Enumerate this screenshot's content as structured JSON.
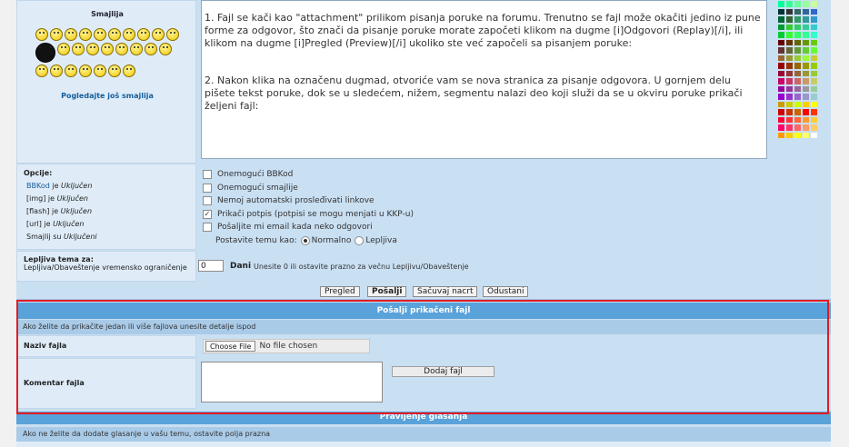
{
  "smilies": {
    "title": "Smajlija",
    "more_link": "Pogledajte još smajlija"
  },
  "editor": {
    "paragraph1": "1. Fajl se kači kao \"attachment\" prilikom pisanja poruke na forumu. Trenutno se fajl može okačiti jedino iz pune forme za odgovor, što znači da pisanje poruke morate započeti klikom na dugme [i]Odgovori (Replay)[/i], ili klikom na dugme [i]Pregled (Preview)[/i] ukoliko ste već započeli sa pisanjem poruke:",
    "paragraph2": "2. Nakon klika na označenu dugmad, otvoriće vam se nova stranica za pisanje odgovora. U gornjem delu pišete tekst poruke, dok se u sledećem, nižem, segmentu nalazi deo koji služi da se u okviru poruke prikači željeni fajl:"
  },
  "palette": {
    "colors": [
      "#00ff99",
      "#33ff99",
      "#66ff99",
      "#99ff99",
      "#ccff99",
      "#003333",
      "#333333",
      "#336666",
      "#336699",
      "#3366cc",
      "#006633",
      "#336633",
      "#339966",
      "#339999",
      "#3399cc",
      "#009933",
      "#33cc33",
      "#33cc66",
      "#33cc99",
      "#33cccc",
      "#00cc33",
      "#33ff33",
      "#33ff66",
      "#33ff99",
      "#33ffcc",
      "#660000",
      "#663300",
      "#666600",
      "#669900",
      "#66cc00",
      "#663333",
      "#666633",
      "#669933",
      "#66cc33",
      "#66ff33",
      "#996633",
      "#999933",
      "#99cc33",
      "#99ff33",
      "#cccc33",
      "#990000",
      "#993300",
      "#996600",
      "#999900",
      "#99cc00",
      "#990033",
      "#993333",
      "#996633",
      "#999933",
      "#99cc33",
      "#cc0066",
      "#cc3366",
      "#cc6666",
      "#cc9966",
      "#cccc66",
      "#990099",
      "#993399",
      "#996699",
      "#999999",
      "#99cc99",
      "#9900cc",
      "#9933cc",
      "#9966cc",
      "#9999cc",
      "#99cccc",
      "#cc9900",
      "#cccc00",
      "#ccff00",
      "#ffcc00",
      "#ffff00",
      "#cc0000",
      "#cc3300",
      "#cc6600",
      "#ff0000",
      "#ff3300",
      "#ff0033",
      "#ff3333",
      "#ff6633",
      "#ff9933",
      "#ffcc33",
      "#ff0066",
      "#ff3366",
      "#ff6666",
      "#ff9966",
      "#ffcc66",
      "#ff9900",
      "#ffcc00",
      "#ffff00",
      "#ffff66",
      "#ffffff"
    ]
  },
  "options": {
    "title": "Opcije:",
    "bbcode_link": "BBKod",
    "bbcode_suffix": " je ",
    "bbcode_state": "Uključen",
    "img_prefix": "[img] je ",
    "img_state": "Uključen",
    "flash_prefix": "[flash] je ",
    "flash_state": "Uključen",
    "url_prefix": "[url] je ",
    "url_state": "Uključen",
    "smilies_prefix": "Smajlij su ",
    "smilies_state": "Uključeni"
  },
  "checkboxes": [
    {
      "label": "Onemogući BBKod",
      "checked": false
    },
    {
      "label": "Onemogući smajlije",
      "checked": false
    },
    {
      "label": "Nemoj automatski prosleđivati linkove",
      "checked": false
    },
    {
      "label": "Prikači potpis (potpisi se mogu menjati u KKP-u)",
      "checked": true
    },
    {
      "label": "Pošaljite mi email kada neko odgovori",
      "checked": false
    }
  ],
  "topic_type": {
    "label": "Postavite temu kao:",
    "normal": "Normalno",
    "sticky": "Lepljiva"
  },
  "sticky": {
    "title": "Lepljiva tema za:",
    "desc": "Lepljiva/Obaveštenje vremensko ograničenje",
    "days_value": "0",
    "days_label": "Dani",
    "hint": "Unesite 0 ili ostavite prazno za večnu Lepljivu/Obaveštenje"
  },
  "buttons": {
    "preview": "Pregled",
    "submit": "Pošalji",
    "save_draft": "Sačuvaj nacrt",
    "cancel": "Odustani"
  },
  "attachment": {
    "header": "Pošalji prikačeni fajl",
    "desc": "Ako želite da prikačite jedan ili više fajlova unesite detalje ispod",
    "filename_label": "Naziv fajla",
    "choose_file": "Choose File",
    "no_file": "No file chosen",
    "comment_label": "Komentar fajla",
    "add_file": "Dodaj fajl"
  },
  "poll": {
    "header": "Pravljenje glasanja",
    "desc": "Ako ne želite da dodate glasanje u vašu temu, ostavite polja prazna"
  },
  "colors": {
    "highlight": "#e11b22",
    "header_bg": "#5aa2da",
    "link": "#135d9b"
  }
}
